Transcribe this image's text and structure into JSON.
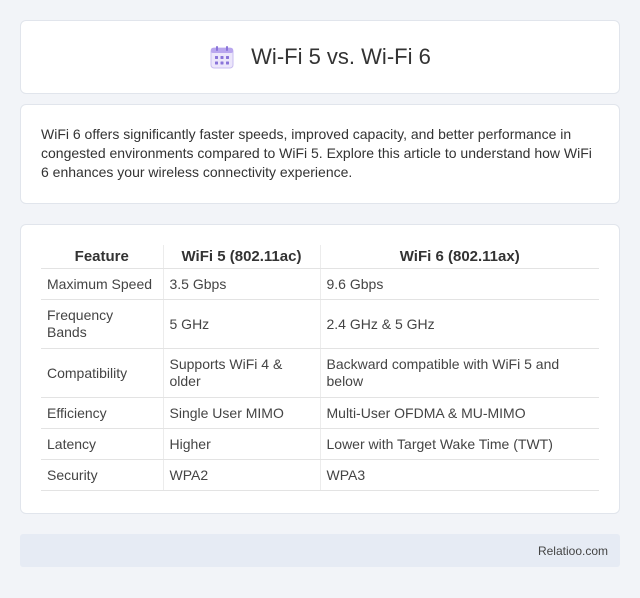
{
  "header": {
    "title": "Wi-Fi 5 vs. Wi-Fi 6",
    "icon": "calendar-icon"
  },
  "intro": {
    "text": "WiFi 6 offers significantly faster speeds, improved capacity, and better performance in congested environments compared to WiFi 5. Explore this article to understand how WiFi 6 enhances your wireless connectivity experience."
  },
  "table": {
    "headers": [
      "Feature",
      "WiFi 5 (802.11ac)",
      "WiFi 6 (802.11ax)"
    ],
    "rows": [
      [
        "Maximum Speed",
        "3.5 Gbps",
        "9.6 Gbps"
      ],
      [
        "Frequency Bands",
        "5 GHz",
        "2.4 GHz & 5 GHz"
      ],
      [
        "Compatibility",
        "Supports WiFi 4 & older",
        "Backward compatible with WiFi 5 and below"
      ],
      [
        "Efficiency",
        "Single User MIMO",
        "Multi-User OFDMA & MU-MIMO"
      ],
      [
        "Latency",
        "Higher",
        "Lower with Target Wake Time (TWT)"
      ],
      [
        "Security",
        "WPA2",
        "WPA3"
      ]
    ]
  },
  "footer": {
    "brand": "Relatioo.com"
  }
}
